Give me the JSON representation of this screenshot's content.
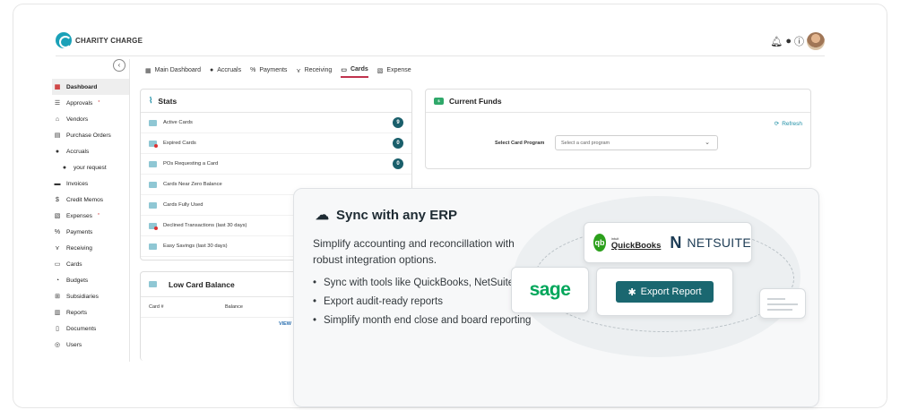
{
  "brand": {
    "name": "CHARITY CHARGE"
  },
  "header": {
    "icons": [
      "bell-icon",
      "chat-icon",
      "help-icon"
    ]
  },
  "sidebar": {
    "collapse_glyph": "‹",
    "items": [
      {
        "label": "Dashboard",
        "icon": "dashboard-icon",
        "glyph": "▦",
        "active": true
      },
      {
        "label": "Approvals",
        "icon": "list-icon",
        "glyph": "☰",
        "badge": "*"
      },
      {
        "label": "Vendors",
        "icon": "store-icon",
        "glyph": "⌂"
      },
      {
        "label": "Purchase Orders",
        "icon": "cart-icon",
        "glyph": "▤"
      },
      {
        "label": "Accruals",
        "icon": "coin-icon",
        "glyph": "●"
      },
      {
        "label": "your request",
        "icon": "coin-icon",
        "glyph": "●",
        "sub": true
      },
      {
        "label": "Invoices",
        "icon": "invoice-icon",
        "glyph": "▬"
      },
      {
        "label": "Credit Memos",
        "icon": "credit-icon",
        "glyph": "$"
      },
      {
        "label": "Expenses",
        "icon": "expense-icon",
        "glyph": "▧",
        "badge": "*"
      },
      {
        "label": "Payments",
        "icon": "payment-icon",
        "glyph": "%"
      },
      {
        "label": "Receiving",
        "icon": "receiving-icon",
        "glyph": "⋎"
      },
      {
        "label": "Cards",
        "icon": "card-icon",
        "glyph": "▭"
      },
      {
        "label": "Budgets",
        "icon": "budget-icon",
        "glyph": "◔"
      },
      {
        "label": "Subsidiaries",
        "icon": "org-icon",
        "glyph": "⊞"
      },
      {
        "label": "Reports",
        "icon": "report-icon",
        "glyph": "▥"
      },
      {
        "label": "Documents",
        "icon": "document-icon",
        "glyph": "▯"
      },
      {
        "label": "Users",
        "icon": "user-icon",
        "glyph": "◎"
      }
    ]
  },
  "tabs": [
    {
      "label": "Main Dashboard",
      "glyph": "▦",
      "icon": "dashboard-icon"
    },
    {
      "label": "Accruals",
      "glyph": "●",
      "icon": "coin-icon"
    },
    {
      "label": "Payments",
      "glyph": "%",
      "icon": "payment-icon"
    },
    {
      "label": "Receiving",
      "glyph": "⋎",
      "icon": "receiving-icon"
    },
    {
      "label": "Cards",
      "glyph": "▭",
      "icon": "card-icon",
      "active": true
    },
    {
      "label": "Expense",
      "glyph": "▧",
      "icon": "expense-icon"
    }
  ],
  "stats": {
    "title": "Stats",
    "rows": [
      {
        "label": "Active Cards",
        "count": "9"
      },
      {
        "label": "Expired Cards",
        "count": "0"
      },
      {
        "label": "POs Requesting a Card",
        "count": "0"
      },
      {
        "label": "Cards Near Zero Balance",
        "count": ""
      },
      {
        "label": "Cards Fully Used",
        "count": ""
      },
      {
        "label": "Declined Transactions (last 30 days)",
        "count": ""
      },
      {
        "label": "Easy Savings (last 30 days)",
        "count": ""
      }
    ]
  },
  "low_card": {
    "title": "Low Card Balance",
    "col_card": "Card #",
    "col_balance": "Balance",
    "view_link": "VIEW"
  },
  "funds": {
    "title": "Current Funds",
    "refresh_label": "Refresh",
    "program_label": "Select Card Program",
    "program_placeholder": "Select a card program"
  },
  "erp": {
    "title": "Sync with any ERP",
    "description": "Simplify accounting and reconcillation with robust integration options.",
    "bullets": [
      "Sync with tools like QuickBooks, NetSuite, and Sage",
      "Export audit-ready reports",
      "Simplify month end close and board reporting"
    ],
    "qb_small": "intuit",
    "qb_big": "QuickBooks",
    "ns_text": "NETSUITE",
    "sage_text": "sage",
    "export_label": "Export Report"
  }
}
